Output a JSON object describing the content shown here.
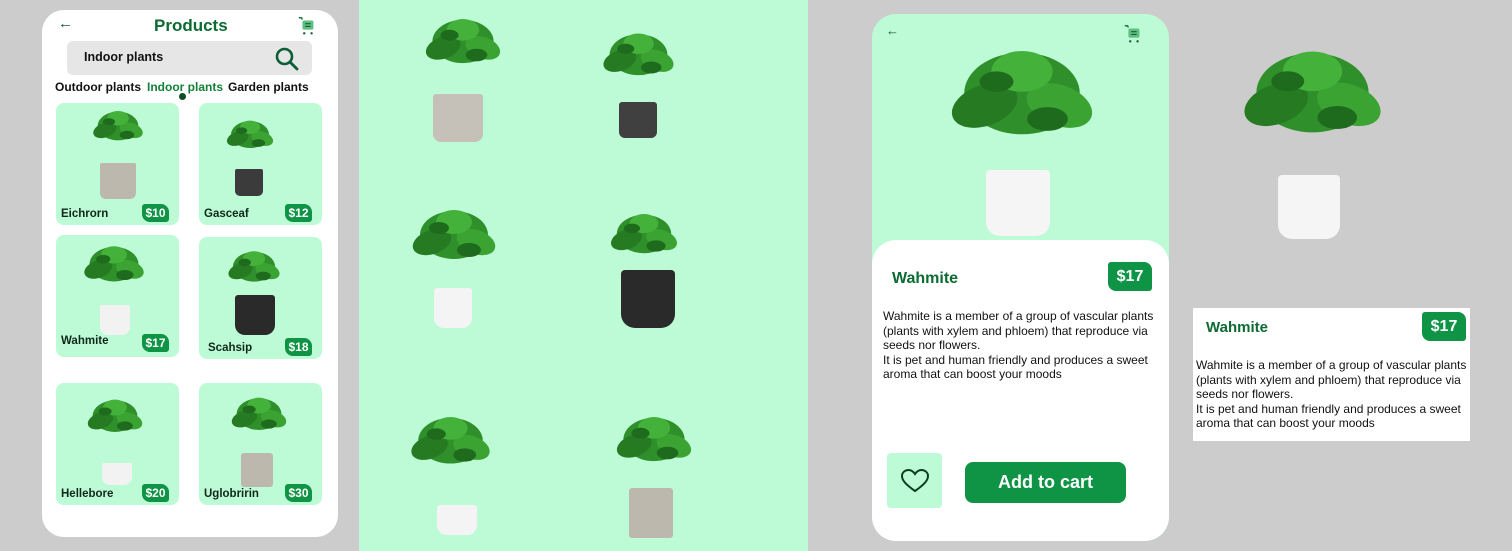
{
  "colors": {
    "primary_green": "#0e9444",
    "title_green": "#0b6b30",
    "mint": "#bdfbd6",
    "canvas": "#cccccc"
  },
  "products_screen": {
    "back_icon": "arrow-left-icon",
    "title": "Products",
    "cart_icon": "shopping-cart-icon",
    "search": {
      "value": "Indoor plants",
      "icon": "search-icon"
    },
    "tabs": [
      {
        "label": "Outdoor plants",
        "active": false
      },
      {
        "label": "Indoor plants",
        "active": true
      },
      {
        "label": "Garden plants",
        "active": false
      }
    ],
    "products": [
      {
        "name": "Eichrorn",
        "price": "$10"
      },
      {
        "name": "Gasceaf",
        "price": "$12"
      },
      {
        "name": "Wahmite",
        "price": "$17"
      },
      {
        "name": "Scahsip",
        "price": "$18"
      },
      {
        "name": "Hellebore",
        "price": "$20"
      },
      {
        "name": "Uglobririn",
        "price": "$30"
      }
    ]
  },
  "detail_screen": {
    "back_icon": "arrow-left-icon",
    "cart_icon": "shopping-cart-icon",
    "name": "Wahmite",
    "price": "$17",
    "description": [
      "Wahmite is a member of a group of vascular plants",
      "(plants with xylem and phloem) that reproduce via",
      "seeds nor flowers.",
      "It is pet and human friendly and produces a sweet",
      "aroma  that can boost your moods"
    ],
    "favorite_icon": "heart-icon",
    "add_to_cart_label": "Add  to cart"
  },
  "detail_card_standalone": {
    "name": "Wahmite",
    "price": "$17",
    "description": [
      "Wahmite is a member of a group of vascular plants",
      "(plants with xylem and phloem) that reproduce via",
      "seeds nor flowers.",
      "It is pet and human friendly and produces a sweet",
      "aroma  that can boost your moods"
    ]
  }
}
